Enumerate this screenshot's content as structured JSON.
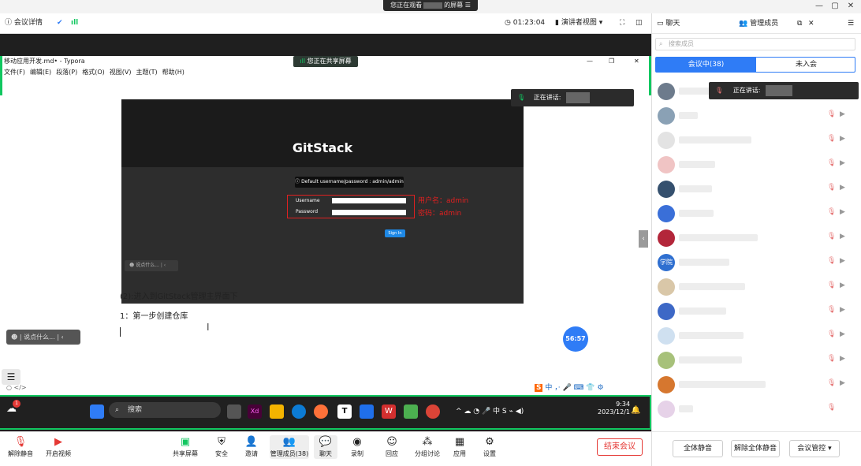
{
  "window": {
    "viewing_prefix": "您正在观看",
    "viewing_suffix": "的屏幕",
    "min": "—",
    "max": "▢",
    "close": "✕"
  },
  "meeting_bar": {
    "details": "会议详情",
    "timer": "01:23:04",
    "view_mode": "演讲者视图"
  },
  "stage": {
    "typora_title": "移动应用开发.md• - Typora",
    "menu": [
      "文件(F)",
      "编辑(E)",
      "段落(P)",
      "格式(O)",
      "视图(V)",
      "主题(T)",
      "帮助(H)"
    ],
    "sharing_label": "您正在共享屏幕",
    "speaking_label": "正在讲话:",
    "timer_bubble": "56:57",
    "say_placeholder": "说点什么...",
    "gitstack": {
      "title": "GitStack",
      "hint": "Default username/password : admin/admin",
      "username_label": "Username",
      "password_label": "Password",
      "sign_in": "Sign In",
      "note_user": "用户名：admin",
      "note_pass": "密码：admin",
      "say_placeholder": "说点什么..."
    },
    "doc_line1": "(2):进入到GitStack管理主界面下",
    "doc_line2": "1：第一步创建仓库",
    "code_marker": "</>",
    "ime": "中 ，· ",
    "taskbar": {
      "search": "搜索",
      "time": "9:34",
      "date": "2023/12/1",
      "lang": "中",
      "badge": "1"
    }
  },
  "bottom_bar": {
    "mute": "解除静音",
    "video": "开启视频",
    "share": "共享屏幕",
    "security": "安全",
    "invite": "邀请",
    "members": "管理成员(38)",
    "chat": "聊天",
    "record": "录制",
    "react": "回应",
    "breakout": "分组讨论",
    "apps": "应用",
    "settings": "设置",
    "end": "结束会议"
  },
  "right_panel": {
    "chat_tab": "聊天",
    "members_tab": "管理成员",
    "search_placeholder": "搜索成员",
    "in_meeting": "会议中(38)",
    "not_joined": "未入会",
    "speaking_label": "正在讲话:",
    "avatar_text_school": "学院",
    "mute_all": "全体静音",
    "unmute_all": "解除全体静音",
    "meeting_control": "会议管控"
  },
  "colors": {
    "accent": "#2f7cf6",
    "green": "#11c760",
    "danger": "#e53935"
  }
}
